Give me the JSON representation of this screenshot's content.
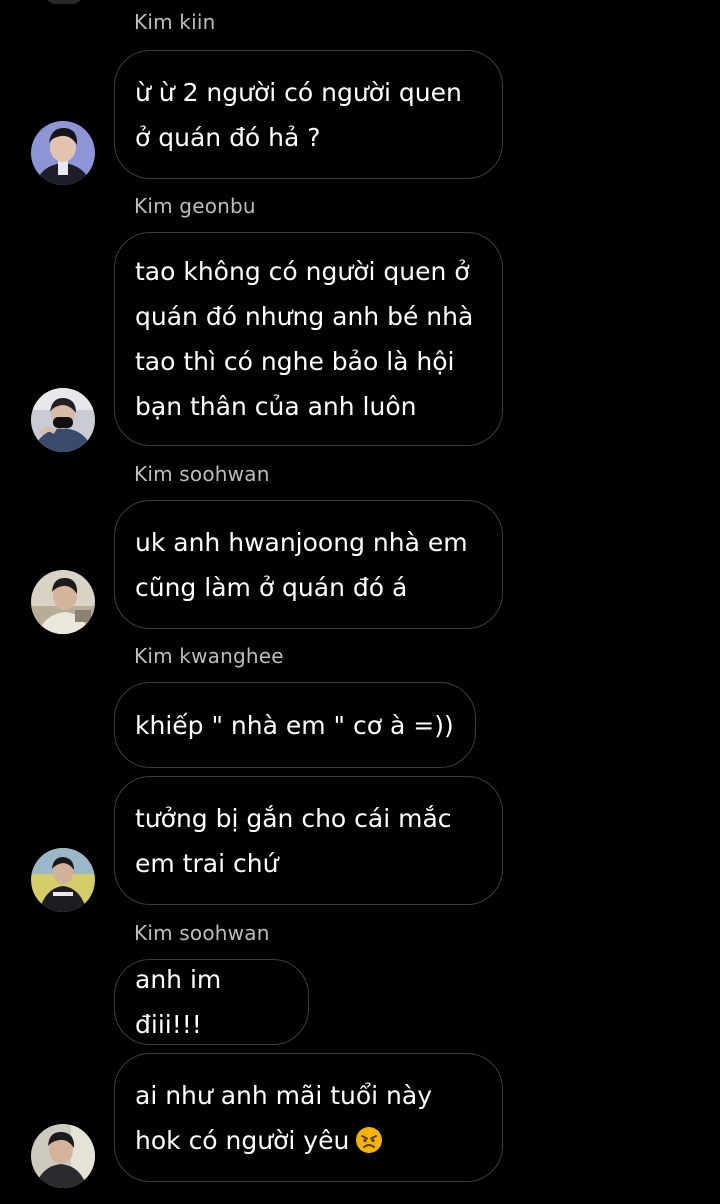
{
  "messages": [
    {
      "sender": "Kim kiin",
      "bubbles": [
        "ừ ừ 2 người có người quen\nở quán đó hả ?"
      ]
    },
    {
      "sender": "Kim geonbu",
      "bubbles": [
        "tao không có người quen ở\nquán đó nhưng anh bé nhà\ntao thì có nghe bảo là hội\nbạn thân của anh luôn"
      ]
    },
    {
      "sender": "Kim soohwan",
      "bubbles": [
        "uk anh hwanjoong nhà em\ncũng làm ở quán đó á"
      ]
    },
    {
      "sender": "Kim kwanghee",
      "bubbles": [
        "khiếp \" nhà em \" cơ à =))",
        "tưởng bị gắn cho cái mắc\nem trai chứ"
      ]
    },
    {
      "sender": "Kim soohwan",
      "bubbles": [
        "anh im điii!!!",
        "ai như anh mãi tuổi này\nhok có người yêu"
      ]
    }
  ],
  "emoji": {
    "name": "angry-face-emoji",
    "color": "#f4b400"
  },
  "colors": {
    "background": "#000000",
    "bubble_border": "#3c3c3c",
    "sender_name": "#bdbdbd",
    "text": "#ffffff"
  }
}
